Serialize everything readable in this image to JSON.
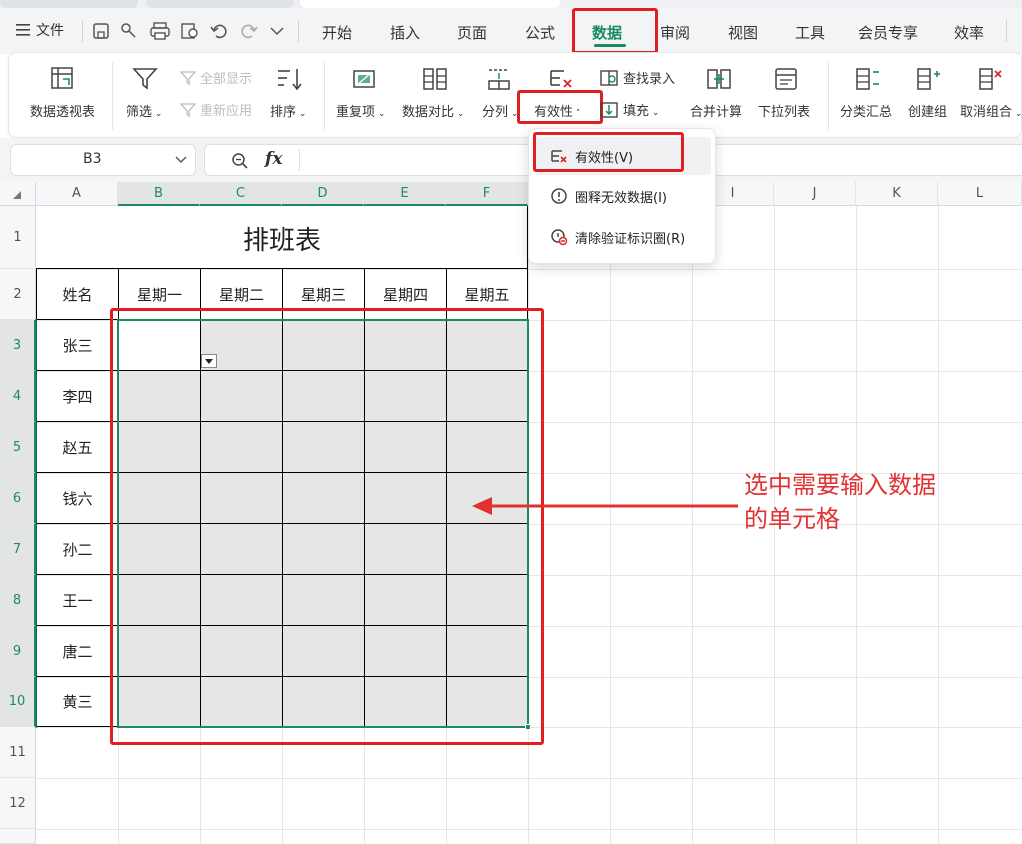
{
  "menubar": {
    "menu_label": "文件",
    "tabs": [
      "开始",
      "插入",
      "页面",
      "公式",
      "数据",
      "审阅",
      "视图",
      "工具",
      "会员专享",
      "效率"
    ],
    "active_tab": "数据"
  },
  "ribbon": {
    "pivot_table": "数据透视表",
    "filter": "筛选",
    "show_all": "全部显示",
    "reapply": "重新应用",
    "sort": "排序",
    "duplicates": "重复项",
    "compare": "数据对比",
    "split": "分列",
    "validation": "有效性",
    "find_entry": "查找录入",
    "fill": "填充",
    "consolidate": "合并计算",
    "dropdown_list": "下拉列表",
    "subtotal": "分类汇总",
    "group": "创建组",
    "ungroup": "取消组合"
  },
  "formula_bar": {
    "cell_ref": "B3",
    "fx_label": "fx",
    "formula": ""
  },
  "dropdown": {
    "items": [
      "有效性(V)",
      "圈释无效数据(I)",
      "清除验证标识圈(R)"
    ]
  },
  "sheet": {
    "columns": [
      "A",
      "B",
      "C",
      "D",
      "E",
      "F",
      "",
      "",
      "I",
      "J",
      "K",
      "L"
    ],
    "rows": [
      "1",
      "2",
      "3",
      "4",
      "5",
      "6",
      "7",
      "8",
      "9",
      "10",
      "11",
      "12"
    ],
    "title": "排班表",
    "header_name": "姓名",
    "weekdays": [
      "星期一",
      "星期二",
      "星期三",
      "星期四",
      "星期五"
    ],
    "names": [
      "张三",
      "李四",
      "赵五",
      "钱六",
      "孙二",
      "王一",
      "唐二",
      "黄三"
    ]
  },
  "annotation": {
    "callout_line1": "选中需要输入数据",
    "callout_line2": "的单元格",
    "accent_color": "#e02020"
  },
  "colors": {
    "selection": "#1e8a5f",
    "active_tab": "#1e8a5f",
    "shade": "#e6e6e6"
  }
}
